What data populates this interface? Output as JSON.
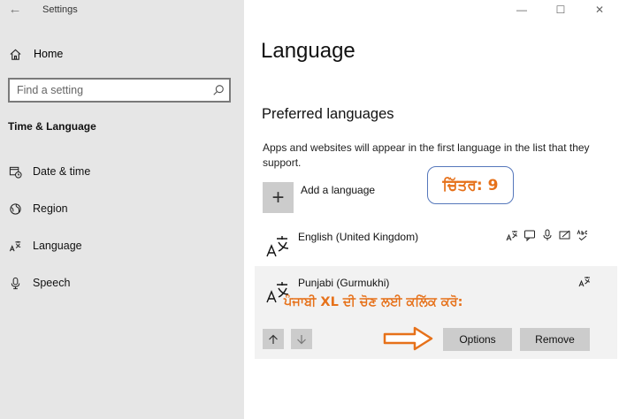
{
  "window": {
    "title": "Settings",
    "controls": [
      "minimize-icon",
      "maximize-icon",
      "close-icon"
    ]
  },
  "sidebar": {
    "home_label": "Home",
    "search_placeholder": "Find a setting",
    "section_title": "Time & Language",
    "items": [
      {
        "label": "Date & time",
        "icon": "calendar-clock-icon"
      },
      {
        "label": "Region",
        "icon": "globe-icon"
      },
      {
        "label": "Language",
        "icon": "language-icon"
      },
      {
        "label": "Speech",
        "icon": "microphone-icon"
      }
    ]
  },
  "main": {
    "title": "Language",
    "preferred_title": "Preferred languages",
    "description": "Apps and websites will appear in the first language in the list that they support.",
    "add_language_label": "Add a language",
    "callout_text": "ਚਿੱਤਰ: 9",
    "languages": [
      {
        "name": "English (United Kingdom)",
        "features": [
          "display-language-icon",
          "speech-icon",
          "mic-icon",
          "handwriting-icon",
          "spellcheck-icon"
        ]
      },
      {
        "name": "Punjabi (Gurmukhi)",
        "features": [
          "display-language-icon"
        ]
      }
    ],
    "annotation_text": "ਪੰਜਾਬੀ XL ਦੀ ਚੋਣ ਲਈ ਕਲਿੱਕ ਕਰੋ:",
    "options_label": "Options",
    "remove_label": "Remove"
  },
  "colors": {
    "sidebar_bg": "#e6e6e6",
    "button_bg": "#cccccc",
    "selected_row_bg": "#f2f2f2",
    "annotation_orange": "#e6711a",
    "callout_border": "#5577bb"
  }
}
